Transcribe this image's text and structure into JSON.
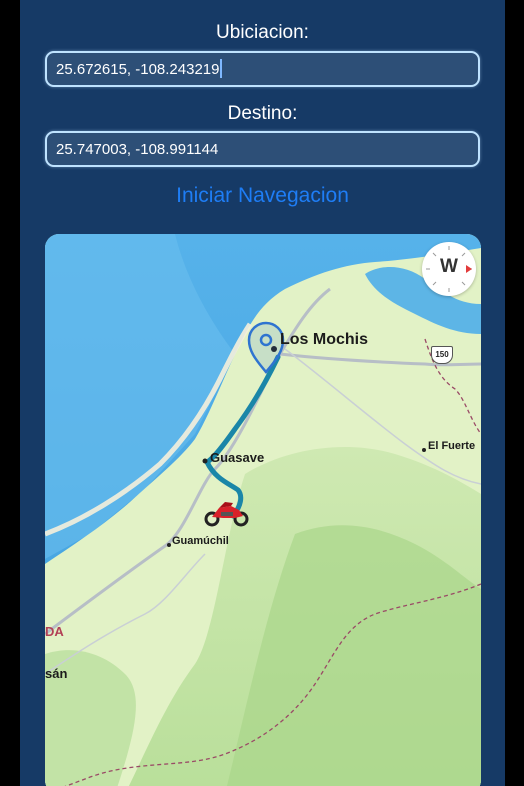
{
  "form": {
    "origin_label": "Ubiciacion:",
    "origin_value": "25.672615, -108.243219",
    "destination_label": "Destino:",
    "destination_value": "25.747003, -108.991144",
    "start_button": "Iniciar Navegacion"
  },
  "map": {
    "compass_letter": "W",
    "labels": {
      "los_mochis": "Los Mochis",
      "guasave": "Guasave",
      "el_fuerte": "El Fuerte",
      "guamuchil": "Guamúchil",
      "state_partial": "DA",
      "city_partial": "sán",
      "highway_shield": "150"
    },
    "icons": {
      "destination_marker": "map-pin-icon",
      "vehicle": "motorcycle-icon",
      "compass": "compass-icon"
    },
    "colors": {
      "route": "#1a86a8",
      "water": "#58b3e6",
      "land": "#def0c0",
      "border": "#9a4a66",
      "marker": "#2f74d0",
      "motorcycle": "#d8222a"
    }
  }
}
